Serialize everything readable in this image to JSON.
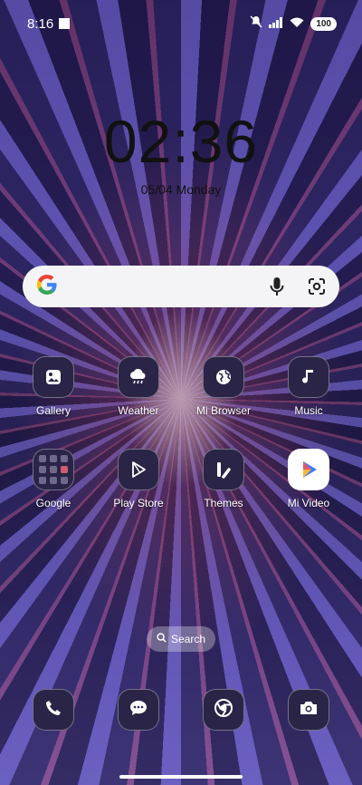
{
  "status_bar": {
    "time": "8:16",
    "battery": "100"
  },
  "lockscreen": {
    "clock": "02:36",
    "date": "05/04 Monday"
  },
  "search_widget": {
    "logo": "google-g-logo",
    "mic_icon": "mic-icon",
    "lens_icon": "lens-icon"
  },
  "apps_row1": [
    {
      "label": "Gallery",
      "icon": "gallery-icon"
    },
    {
      "label": "Weather",
      "icon": "weather-icon"
    },
    {
      "label": "Mi Browser",
      "icon": "globe-icon"
    },
    {
      "label": "Music",
      "icon": "music-note-icon"
    }
  ],
  "apps_row2": [
    {
      "label": "Google",
      "icon": "folder-icon"
    },
    {
      "label": "Play Store",
      "icon": "play-store-icon"
    },
    {
      "label": "Themes",
      "icon": "themes-icon"
    },
    {
      "label": "Mi Video",
      "icon": "mi-video-icon"
    }
  ],
  "search_pill": {
    "label": "Search"
  },
  "dock": [
    {
      "icon": "phone-icon"
    },
    {
      "icon": "messages-icon"
    },
    {
      "icon": "chrome-icon"
    },
    {
      "icon": "camera-icon"
    }
  ],
  "colors": {
    "icon_bg": "#2a2547",
    "search_bg": "#f4f4f6"
  }
}
